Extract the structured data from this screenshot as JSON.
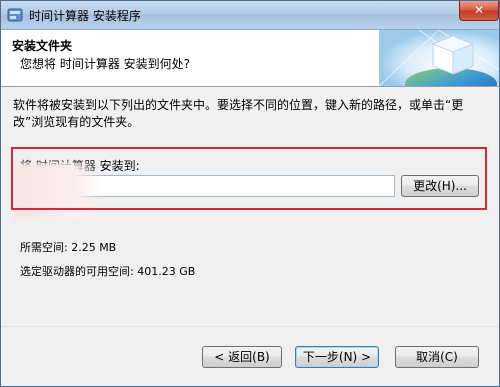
{
  "window": {
    "title": "时间计算器 安装程序",
    "close_glyph": "✕"
  },
  "header": {
    "title": "安装文件夹",
    "subtitle": "您想将 时间计算器 安装到何处?"
  },
  "body": {
    "description": "软件将被安装到以下列出的文件夹中。要选择不同的位置，键入新的路径，或单击“更改”浏览现有的文件夹。",
    "install_label": "将 时间计算器 安装到:",
    "path_value": "",
    "change_button": "更改(H)...",
    "space_required": "所需空间: 2.25 MB",
    "space_available": "选定驱动器的可用空间: 401.23 GB"
  },
  "footer": {
    "back_button": "< 返回(B)",
    "next_button": "下一步(N) >",
    "cancel_button": "取消(C)"
  },
  "colors": {
    "highlight_border": "#d3283a",
    "titlebar": "#b3cce6"
  },
  "icons": {
    "app": "installer-icon",
    "header_graphic": "globe-cube-icon"
  }
}
